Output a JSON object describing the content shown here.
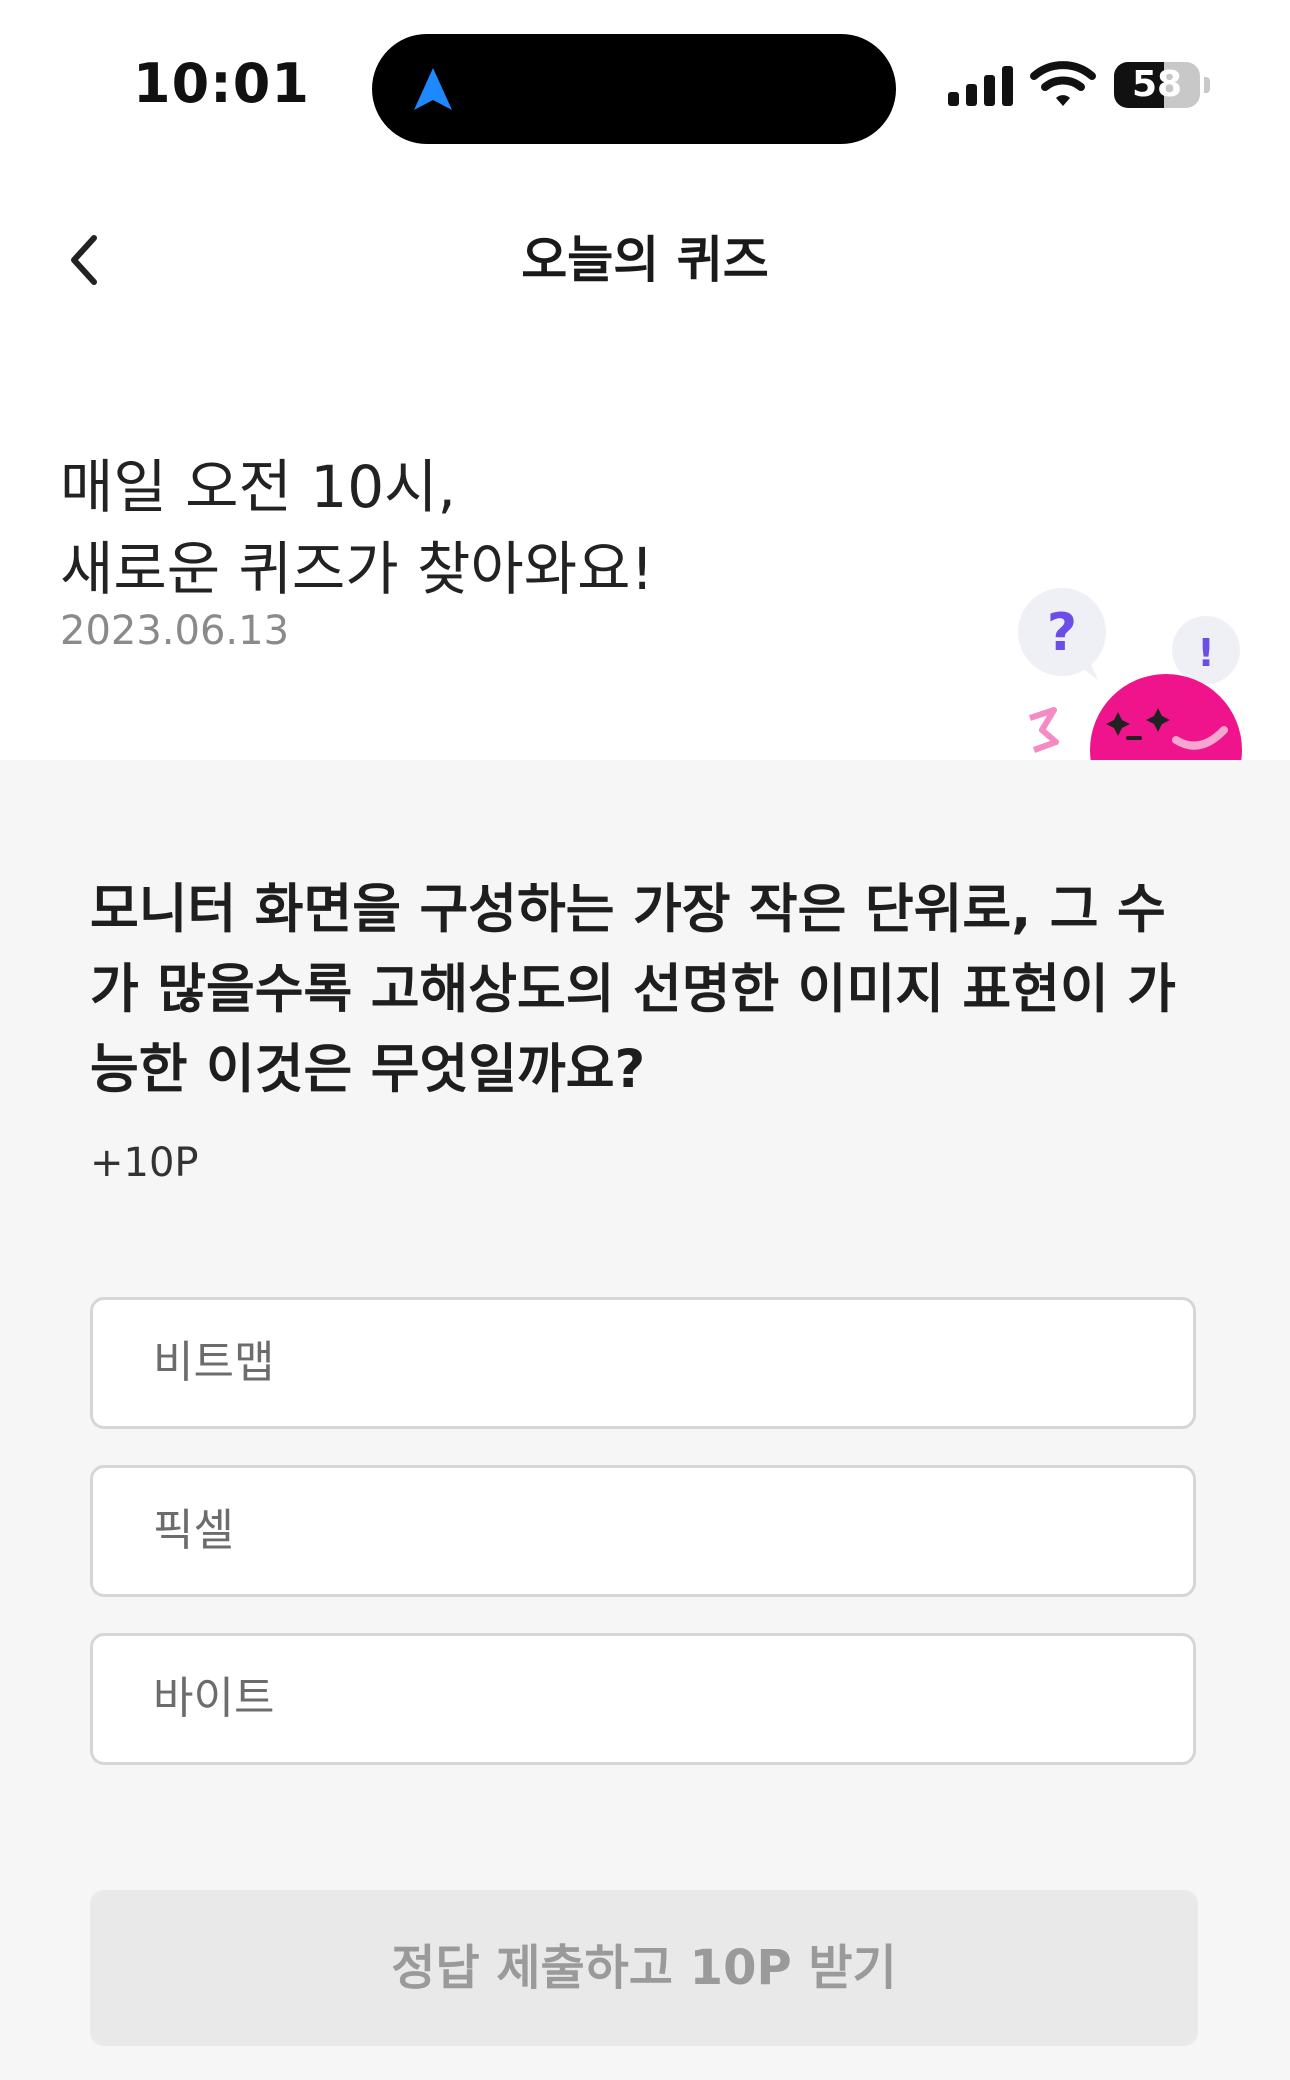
{
  "status_bar": {
    "time": "10:01",
    "battery_level": "58",
    "battery_fraction": 0.58
  },
  "header": {
    "title": "오늘의 퀴즈"
  },
  "intro": {
    "line1": "매일 오전 10시,",
    "line2": "새로운 퀴즈가 찾아와요!",
    "date": "2023.06.13"
  },
  "quiz": {
    "question": "모니터 화면을 구성하는 가장 작은 단위로, 그 수가 많을수록 고해상도의 선명한 이미지 표현이 가능한 이것은 무엇일까요?",
    "points": "+10P",
    "options": [
      {
        "label": "비트맵"
      },
      {
        "label": "픽셀"
      },
      {
        "label": "바이트"
      }
    ],
    "submit_label": "정답 제출하고 10P 받기"
  },
  "colors": {
    "accent_pink": "#f0148c",
    "bubble_purple": "#6b4ee6",
    "bubble_bg": "#efeff6",
    "location_blue": "#1e88ff"
  },
  "icons": {
    "back": "chevron-left-icon",
    "location": "location-arrow-icon",
    "signal": "cellular-signal-icon",
    "wifi": "wifi-icon",
    "battery": "battery-icon",
    "mascot": "quiz-mascot-icon"
  }
}
